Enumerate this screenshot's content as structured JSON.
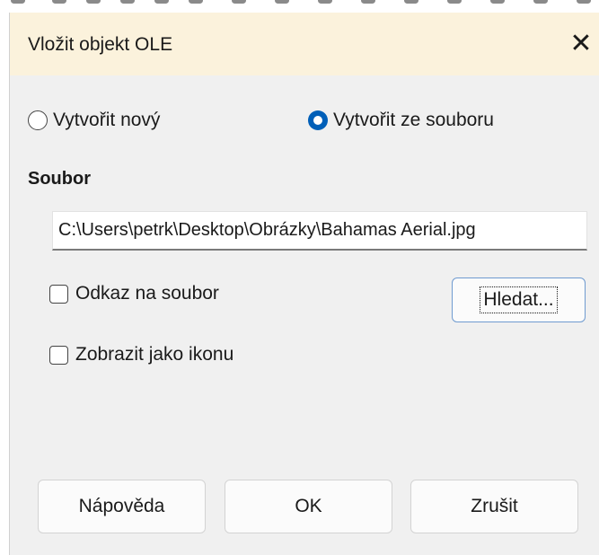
{
  "dialog": {
    "title": "Vložit objekt OLE",
    "close_glyph": "✕"
  },
  "mode": {
    "options": [
      {
        "label": "Vytvořit nový",
        "selected": false
      },
      {
        "label": "Vytvořit ze souboru",
        "selected": true
      }
    ]
  },
  "file": {
    "section_label": "Soubor",
    "path_value": "C:\\Users\\petrk\\Desktop\\Obrázky\\Bahamas Aerial.jpg",
    "link_checkbox": {
      "label": "Odkaz na soubor",
      "checked": false
    },
    "icon_checkbox": {
      "label": "Zobrazit jako ikonu",
      "checked": false
    },
    "browse_label": "Hledat..."
  },
  "buttons": {
    "help": "Nápověda",
    "ok": "OK",
    "cancel": "Zrušit"
  },
  "colors": {
    "titlebar_bg": "#fbf2dc",
    "dialog_bg": "#f0f0f0",
    "accent": "#005fb8"
  }
}
